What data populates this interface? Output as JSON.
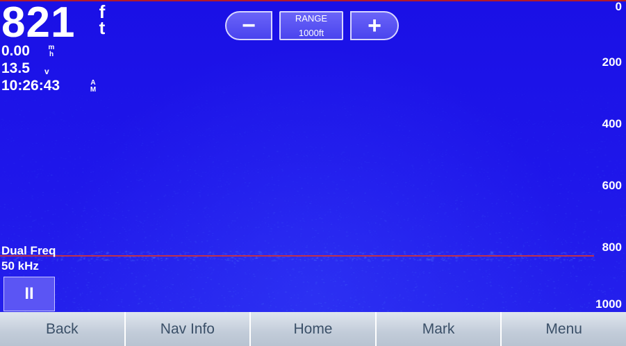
{
  "readouts": {
    "depth_value": "821",
    "depth_unit": "ft",
    "speed_value": "0.00",
    "speed_unit": "mh",
    "voltage_value": "13.5",
    "voltage_unit": "v",
    "time_value": "10:26:43",
    "time_ampm": "AM"
  },
  "range_control": {
    "minus_label": "−",
    "title": "RANGE",
    "value": "1000ft",
    "plus_label": "+"
  },
  "depth_scale": [
    "0",
    "200",
    "400",
    "600",
    "800",
    "1000"
  ],
  "frequency": {
    "label": "Dual Freq",
    "value": "50 kHz"
  },
  "pause_label": "II",
  "softkeys": {
    "back": "Back",
    "nav_info": "Nav Info",
    "home": "Home",
    "mark": "Mark",
    "menu": "Menu"
  },
  "colors": {
    "background": "#1a10e6",
    "bottom_line": "#c0304a",
    "softkey_text": "#3b5068"
  },
  "icons": {
    "pause": "pause-icon"
  }
}
